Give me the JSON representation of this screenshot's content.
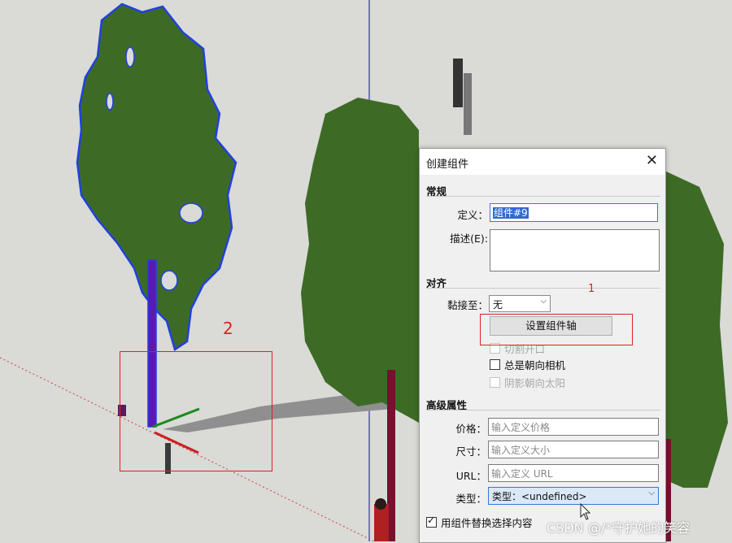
{
  "dialog": {
    "title": "创建组件",
    "close_glyph": "✕",
    "general": {
      "header": "常规",
      "definition_label": "定义：",
      "definition_value": "组件#9",
      "description_label": "描述(E):"
    },
    "alignment": {
      "header": "对齐",
      "glue_label": "黏接至：",
      "glue_value": "无",
      "set_axes_button": "设置组件轴",
      "cut_opening": "切割开口",
      "always_face_camera": "总是朝向相机",
      "shadows_face_sun": "阴影朝向太阳"
    },
    "advanced": {
      "header": "高级属性",
      "price_label": "价格：",
      "price_placeholder": "输入定义价格",
      "size_label": "尺寸：",
      "size_placeholder": "输入定义大小",
      "url_label": "URL：",
      "url_placeholder": "输入定义 URL",
      "type_label": "类型：",
      "type_value": "类型：<undefined>"
    },
    "replace_selection_label": "用组件替换选择内容"
  },
  "annotations": {
    "one": "1",
    "two": "2"
  },
  "watermark": "CSDN @/*守护她的笑容",
  "colors": {
    "foliage": "#3d6b26",
    "foliage_outline": "#2040e0",
    "trunk": "#7a1030",
    "annotation": "#e02020",
    "axis_green": "#1a8a1a",
    "axis_red": "#cc2020",
    "axis_blue": "#3030d0"
  }
}
